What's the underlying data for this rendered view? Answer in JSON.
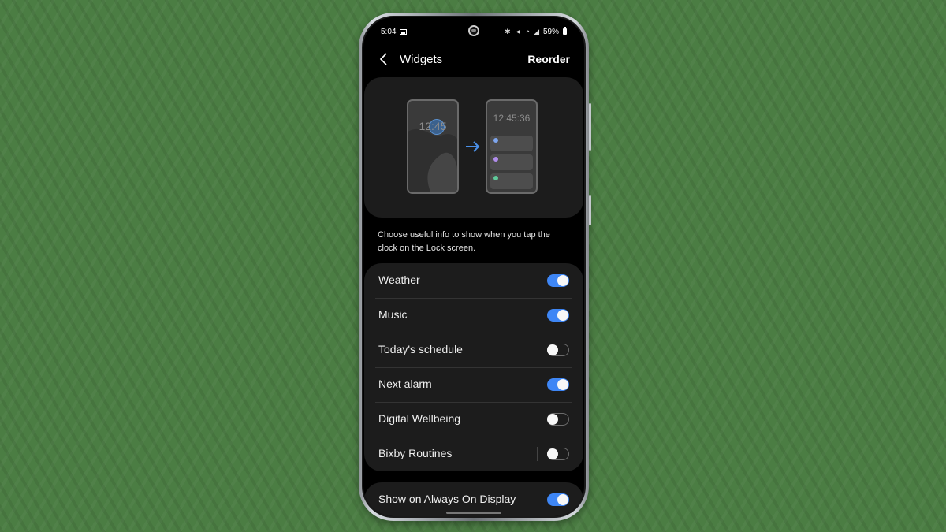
{
  "status_bar": {
    "time": "5:04",
    "left_icons": [
      "gallery-notification-icon"
    ],
    "right_icons": [
      "bluetooth-icon",
      "mute-icon",
      "wifi-icon",
      "signal-icon"
    ],
    "battery": "59%"
  },
  "app_bar": {
    "back_icon": "chevron-left-icon",
    "title": "Widgets",
    "action_label": "Reorder"
  },
  "illustration": {
    "before_clock": "12:45",
    "after_clock": "12:45:36",
    "arrow_icon": "arrow-right-icon",
    "widget_dot_colors": [
      "#7ea6ef",
      "#b18ded",
      "#5fc99a"
    ]
  },
  "description": "Choose useful info to show when you tap the clock on the Lock screen.",
  "widgets": [
    {
      "label": "Weather",
      "enabled": true
    },
    {
      "label": "Music",
      "enabled": true
    },
    {
      "label": "Today's schedule",
      "enabled": false
    },
    {
      "label": "Next alarm",
      "enabled": true
    },
    {
      "label": "Digital Wellbeing",
      "enabled": false
    },
    {
      "label": "Bixby Routines",
      "enabled": false
    }
  ],
  "aod": {
    "label": "Show on Always On Display",
    "enabled": true
  },
  "colors": {
    "accent": "#3e86f5",
    "background": "#4b7d43"
  }
}
